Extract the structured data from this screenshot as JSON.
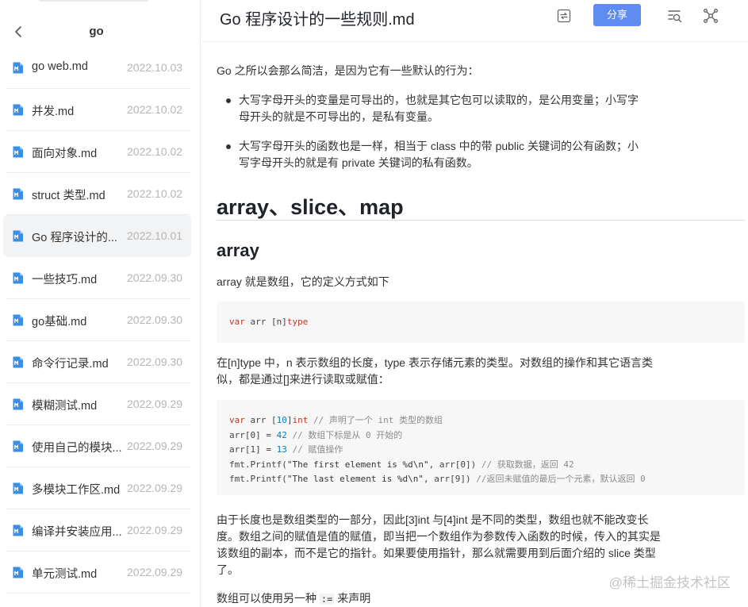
{
  "sidebar": {
    "folder_title": "go",
    "files": [
      {
        "name": "go web.md",
        "date": "2022.10.03"
      },
      {
        "name": "并发.md",
        "date": "2022.10.02"
      },
      {
        "name": "面向对象.md",
        "date": "2022.10.02"
      },
      {
        "name": "struct 类型.md",
        "date": "2022.10.02"
      },
      {
        "name": "Go 程序设计的...",
        "date": "2022.10.01"
      },
      {
        "name": "一些技巧.md",
        "date": "2022.09.30"
      },
      {
        "name": "go基础.md",
        "date": "2022.09.30"
      },
      {
        "name": "命令行记录.md",
        "date": "2022.09.30"
      },
      {
        "name": "模糊测试.md",
        "date": "2022.09.29"
      },
      {
        "name": "使用自己的模块...",
        "date": "2022.09.29"
      },
      {
        "name": "多模块工作区.md",
        "date": "2022.09.29"
      },
      {
        "name": "编译并安装应用...",
        "date": "2022.09.29"
      },
      {
        "name": "单元测试.md",
        "date": "2022.09.29"
      }
    ],
    "active_index": 4
  },
  "topbar": {
    "title": "Go 程序设计的一些规则.md",
    "share_label": "分享"
  },
  "doc": {
    "intro": "Go 之所以会那么简洁，是因为它有一些默认的行为：",
    "bullet1_line1": "大写字母开头的变量是可导出的，也就是其它包可以读取的，是公用变量；小写字",
    "bullet1_line2": "母开头的就是不可导出的，是私有变量。",
    "bullet2_line1": "大写字母开头的函数也是一样，相当于 class 中的带 public 关键词的公有函数；小",
    "bullet2_line2": "写字母开头的就是有 private 关键词的私有函数。",
    "h2": "array、slice、map",
    "h3": "array",
    "array_def": "array 就是数组，它的定义方式如下",
    "code1": {
      "kw": "var",
      "rest": " arr [n]",
      "type": "type"
    },
    "para2_line1": "在[n]type 中，n 表示数组的长度，type 表示存储元素的类型。对数组的操作和其它语言类",
    "para2_line2": "似，都是通过[]来进行读取或赋值：",
    "code2": {
      "l1_kw": "var",
      "l1_a": " arr [",
      "l1_num": "10",
      "l1_b": "]",
      "l1_type": "int",
      "l1_cm": " // 声明了一个 int 类型的数组",
      "l2_a": "arr[0] = ",
      "l2_num": "42",
      "l2_cm": " // 数组下标是从 0 开始的",
      "l3_a": "arr[1] = ",
      "l3_num": "13",
      "l3_cm": " // 赋值操作",
      "l4_a": "fmt.Printf(",
      "l4_str": "\"The first element is %d\\n\"",
      "l4_b": ", arr[0]) ",
      "l4_cm": "// 获取数据，返回 42",
      "l5_a": "fmt.Printf(",
      "l5_str": "\"The last element is %d\\n\"",
      "l5_b": ", arr[9]) ",
      "l5_cm": "//返回未赋值的最后一个元素，默认返回 0"
    },
    "para3_line1": "由于长度也是数组类型的一部分，因此[3]int 与[4]int 是不同的类型，数组也就不能改变长",
    "para3_line2": "度。数组之间的赋值是值的赋值，即当把一个数组作为参数传入函数的时候，传入的其实是",
    "para3_line3": "该数组的副本，而不是它的指针。如果要使用指针，那么就需要用到后面介绍的 slice 类型",
    "para3_line4": "了。",
    "para4_a": "数组可以使用另一种 ",
    "para4_code": ":=",
    "para4_b": " 来声明"
  },
  "watermark": "@稀土掘金技术社区",
  "colors": {
    "accent": "#5e8cf0",
    "md_icon": "#3a8ee6",
    "active_bg": "#f2f3f5"
  }
}
